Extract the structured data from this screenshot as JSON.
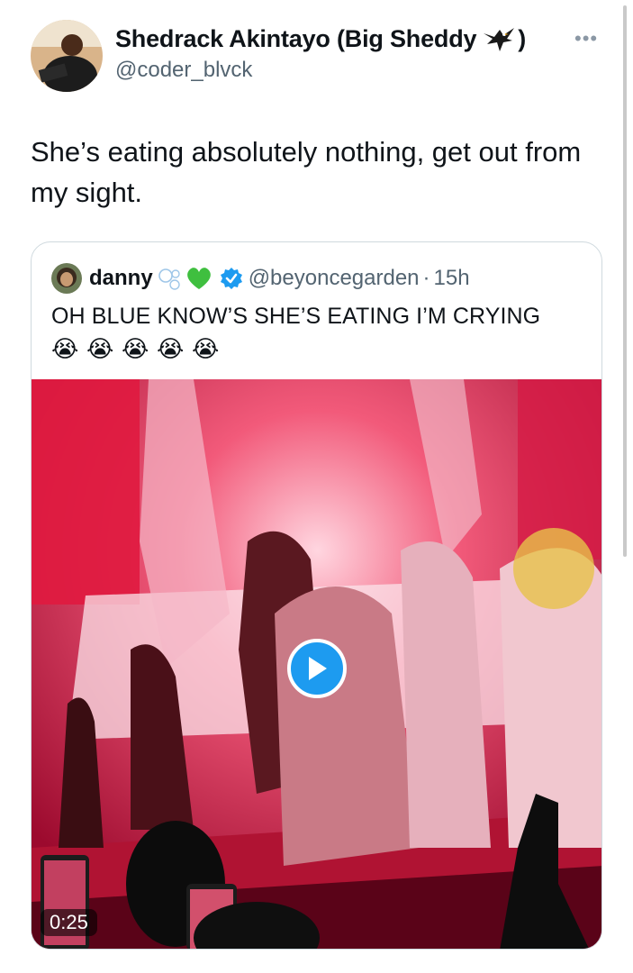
{
  "tweet": {
    "author": {
      "name": "Shedrack Akintayo (Big Sheddy",
      "name_close": ")",
      "emoji_icon": "eagle-icon",
      "handle": "@coder_blvck"
    },
    "more_icon": "more-horizontal-icon",
    "text": "She’s eating absolutely nothing, get out from my sight."
  },
  "quote": {
    "author": {
      "name": "danny",
      "decorations": [
        "bubbles-icon",
        "green-heart-icon"
      ],
      "verified_icon": "verified-badge-icon",
      "handle": "@beyoncegarden",
      "separator": "·",
      "time": "15h"
    },
    "text": "OH BLUE KNOW’S SHE’S EATING I’M CRYING",
    "emojis": [
      "😭",
      "😭",
      "😭",
      "😭",
      "😭"
    ],
    "video": {
      "duration": "0:25",
      "play_icon": "play-icon"
    }
  },
  "colors": {
    "text_primary": "#0f1419",
    "text_secondary": "#536471",
    "accent": "#1d9bf0",
    "border": "#cfd9de"
  }
}
